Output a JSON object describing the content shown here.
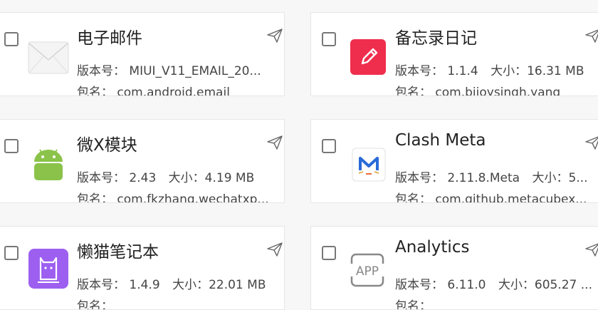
{
  "version_label": "版本号：",
  "size_label": "大小：",
  "package_label": "包名：",
  "cards": [
    {
      "title": "电子邮件",
      "version": "MIUI_V11_EMAIL_20...",
      "size": "",
      "package": "com.android.email",
      "icon": "envelope-icon"
    },
    {
      "title": "备忘录日记",
      "version": "1.1.4",
      "size": "16.31 MB",
      "package": "com.bijoysingh.yang",
      "icon": "pencil-note-icon"
    },
    {
      "title": "微X模块",
      "version": "2.43",
      "size": "4.19 MB",
      "package": "com.fkzhang.wechatxp...",
      "icon": "android-robot-icon"
    },
    {
      "title": "Clash Meta",
      "version": "2.11.8.Meta",
      "size": "5...",
      "package": "com.github.metacubex...",
      "icon": "clash-meta-icon"
    },
    {
      "title": "懒猫笔记本",
      "version": "1.4.9",
      "size": "22.01 MB",
      "package": "",
      "icon": "cat-notebook-icon"
    },
    {
      "title": "Analytics",
      "version": "6.11.0",
      "size": "605.27 ...",
      "package": "",
      "icon": "app-placeholder-icon"
    }
  ],
  "colors": {
    "note_red": "#ef2e4d",
    "android_green": "#8bc34a",
    "cat_purple": "#9d5ff0",
    "clash_blue": "#2a6ad8"
  }
}
